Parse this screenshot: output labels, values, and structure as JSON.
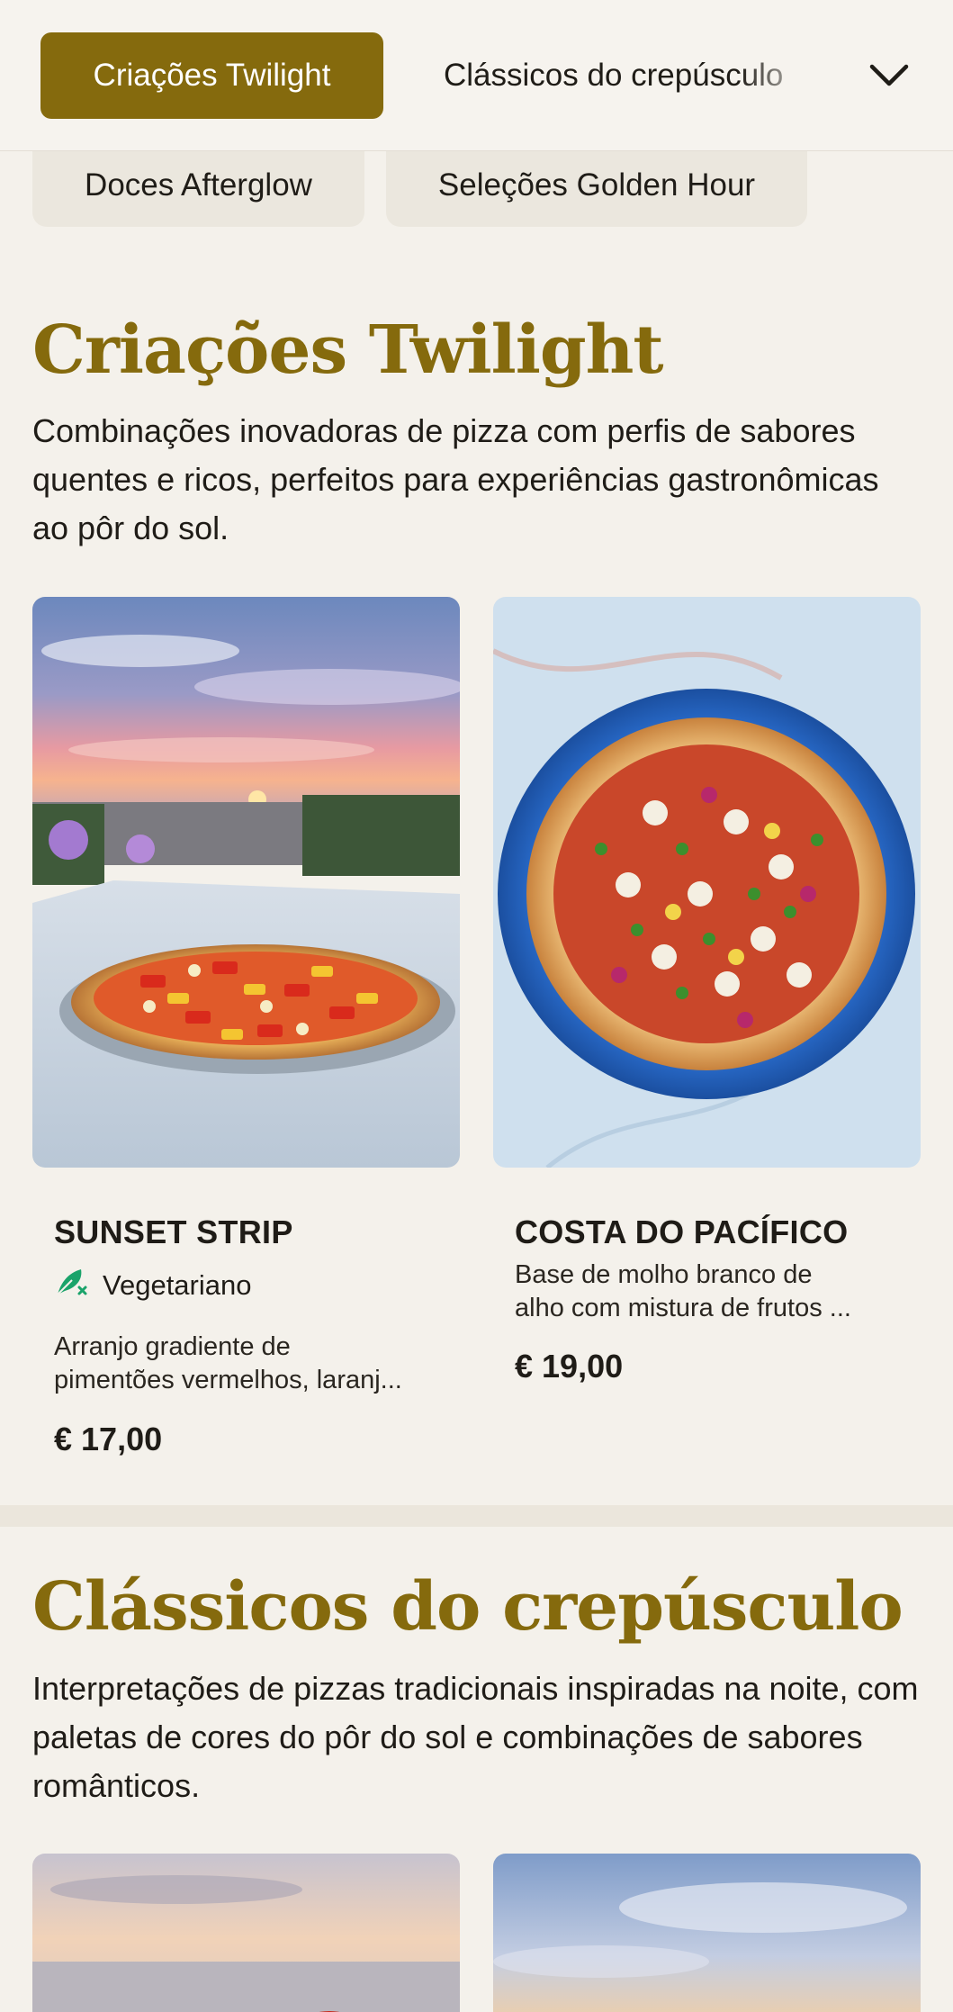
{
  "categories": {
    "active": "Criações Twilight",
    "next": "Clássicos do crepúsculo",
    "chips": [
      "Doces Afterglow",
      "Seleções Golden Hour"
    ]
  },
  "sections": [
    {
      "title": "Criações Twilight",
      "description": "Combinações inovadoras de pizza com perfis de sabores quentes e ricos, perfeitos para experiências gastronômicas ao pôr do sol.",
      "items": [
        {
          "name": "SUNSET STRIP",
          "tag": "Vegetariano",
          "description_lines": [
            "Arranjo gradiente de",
            "pimentões vermelhos, laranj..."
          ],
          "price": "€ 17,00"
        },
        {
          "name": "COSTA DO PACÍFICO",
          "description_lines": [
            "Base de molho branco de",
            "alho com mistura de frutos ..."
          ],
          "price": "€ 19,00"
        }
      ]
    },
    {
      "title": "Clássicos do crepúsculo",
      "description": "Interpretações de pizzas tradicionais inspiradas na noite, com paletas de cores do pôr do sol e combinações de sabores românticos."
    }
  ],
  "colors": {
    "accent": "#856a0d",
    "background": "#f4f1eb",
    "veg_icon": "#1aa36a"
  },
  "icons": {
    "dropdown": "chevron-down-icon",
    "vegetarian": "leaf-icon"
  }
}
